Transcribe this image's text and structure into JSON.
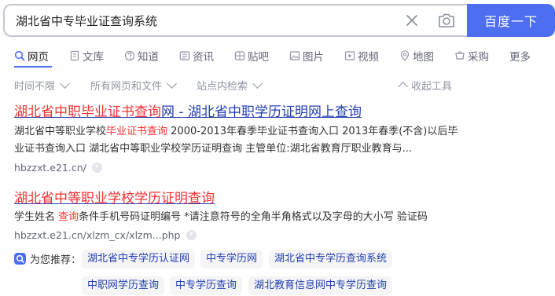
{
  "search": {
    "query": "湖北省中专毕业证查询系统",
    "button_label": "百度一下"
  },
  "tabs": [
    {
      "label": "网页",
      "icon": "search-icon",
      "active": true
    },
    {
      "label": "文库",
      "icon": "document-icon"
    },
    {
      "label": "知道",
      "icon": "question-icon"
    },
    {
      "label": "资讯",
      "icon": "news-icon"
    },
    {
      "label": "贴吧",
      "icon": "tieba-icon"
    },
    {
      "label": "图片",
      "icon": "image-icon"
    },
    {
      "label": "视频",
      "icon": "video-icon"
    },
    {
      "label": "地图",
      "icon": "map-pin-icon"
    },
    {
      "label": "采购",
      "icon": "cart-icon"
    },
    {
      "label": "更多"
    }
  ],
  "filters": {
    "time": "时间不限",
    "type": "所有网页和文件",
    "site": "站点内检索",
    "collapse": "收起工具"
  },
  "results": [
    {
      "title_hl": "湖北省中职毕业证书查询",
      "title_rest": "网 - 湖北省中职学历证明网上查询",
      "snippet_pre": "湖北省中等职业学校",
      "snippet_hl": "毕业证书查询",
      "snippet_post": " 2000-2013年春季毕业证书查询入口 2013年春季(不含)以后毕业证书查询入口 湖北省中等职业学校学历证明查询 主管单位:湖北省教育厅职业教育与...",
      "url": "hbzzxt.e21.cn/"
    },
    {
      "title_hl": "湖北省中等职业学校学历证明查询",
      "snippet_pre": "学生姓名 ",
      "snippet_hl": "查询",
      "snippet_post": "条件手机号码证明编号 *请注意符号的全角半角格式以及字母的大小写 验证码",
      "url": "hbzzxt.e21.cn/xlzm_cx/xlzm...php"
    }
  ],
  "recommend": {
    "label": "为您推荐：",
    "items": [
      "湖北省中专学历认证网",
      "中专学历网",
      "湖北省中专学历查询系统",
      "中职网学历查询",
      "中专学历查询",
      "湖北教育信息网中专学历查询"
    ]
  },
  "colors": {
    "accent": "#4e6ef2",
    "link": "#2440b3",
    "highlight": "#f73131"
  }
}
